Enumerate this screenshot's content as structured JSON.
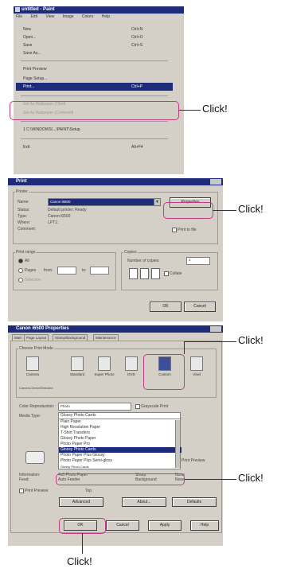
{
  "callout_text": "Click!",
  "paint": {
    "title": "untitled - Paint",
    "menubar": [
      "File",
      "Edit",
      "View",
      "Image",
      "Colors",
      "Help"
    ],
    "items": [
      {
        "label": "New",
        "shortcut": "Ctrl+N"
      },
      {
        "label": "Open...",
        "shortcut": "Ctrl+O"
      },
      {
        "label": "Save",
        "shortcut": "Ctrl+S"
      },
      {
        "label": "Save As...",
        "shortcut": ""
      },
      {
        "label": "Print Preview",
        "shortcut": ""
      },
      {
        "label": "Page Setup...",
        "shortcut": ""
      },
      {
        "label": "Print...",
        "shortcut": "Ctrl+P"
      },
      {
        "label": "Set As Wallpaper (Tiled)",
        "shortcut": ""
      },
      {
        "label": "Set As Wallpaper (Centered)",
        "shortcut": ""
      },
      {
        "label": "1 C:\\WINDOWS\\...\\PAINT\\Setup",
        "shortcut": ""
      },
      {
        "label": "Exit",
        "shortcut": "Alt+F4"
      }
    ]
  },
  "print": {
    "title": "Print",
    "printer_group": "Printer",
    "name_label": "Name:",
    "name_value": "Canon i6500",
    "properties_button": "Properties",
    "status_label": "Status:",
    "status_value": "Default printer; Ready",
    "type_label": "Type:",
    "type_value": "Canon i6500",
    "where_label": "Where:",
    "where_value": "LPT1:",
    "comment_label": "Comment:",
    "print_to_file": "Print to file",
    "range_group": "Print range",
    "all": "All",
    "pages": "Pages",
    "from": "from:",
    "to": "to:",
    "selection": "Selection",
    "copies_group": "Copies",
    "copies_label": "Number of copies:",
    "copies_value": "1",
    "collate": "Collate",
    "ok": "OK",
    "cancel": "Cancel"
  },
  "props": {
    "title": "Canon i6500 Properties",
    "tabs": [
      "Main",
      "Page Layout",
      "Stamp/Background",
      "Maintenance"
    ],
    "mode_group": "Choose Print Mode",
    "modes": [
      "Camera",
      "Standard",
      "Super Photo",
      "DVD",
      "Custom",
      "Vivid"
    ],
    "camera_label": "Camera Direct/Selected",
    "color_label": "Color Reproduction:",
    "color_value": "Photo",
    "grayscale": "Grayscale Print",
    "media_label": "Media Type:",
    "media_value": "Glossy Photo Cards",
    "media_options": [
      "Plain Paper",
      "High Resolution Paper",
      "T-Shirt Transfers",
      "Glossy Photo Paper",
      "Photo Paper Pro",
      "Glossy Photo Cards",
      "Photo Paper Plus Glossy",
      "Photo Paper Plus Semi-gloss",
      "Glossy Photo Cards"
    ],
    "print_preview": "Print Preview",
    "info_a_label": "Information:",
    "info_a_value": "4x6 Photo Paper",
    "info_b_label": "Feed:",
    "info_b_value": "Auto Feeder",
    "info_c_label": "Sharp",
    "info_c_value": "None",
    "info_d_label": "Background",
    "info_d_value": "None",
    "preview_label": "Print Preview",
    "preview_value": "Top",
    "advanced": "Advanced",
    "about": "About...",
    "defaults": "Defaults",
    "ok": "OK",
    "cancel": "Cancel",
    "apply": "Apply",
    "help": "Help"
  }
}
